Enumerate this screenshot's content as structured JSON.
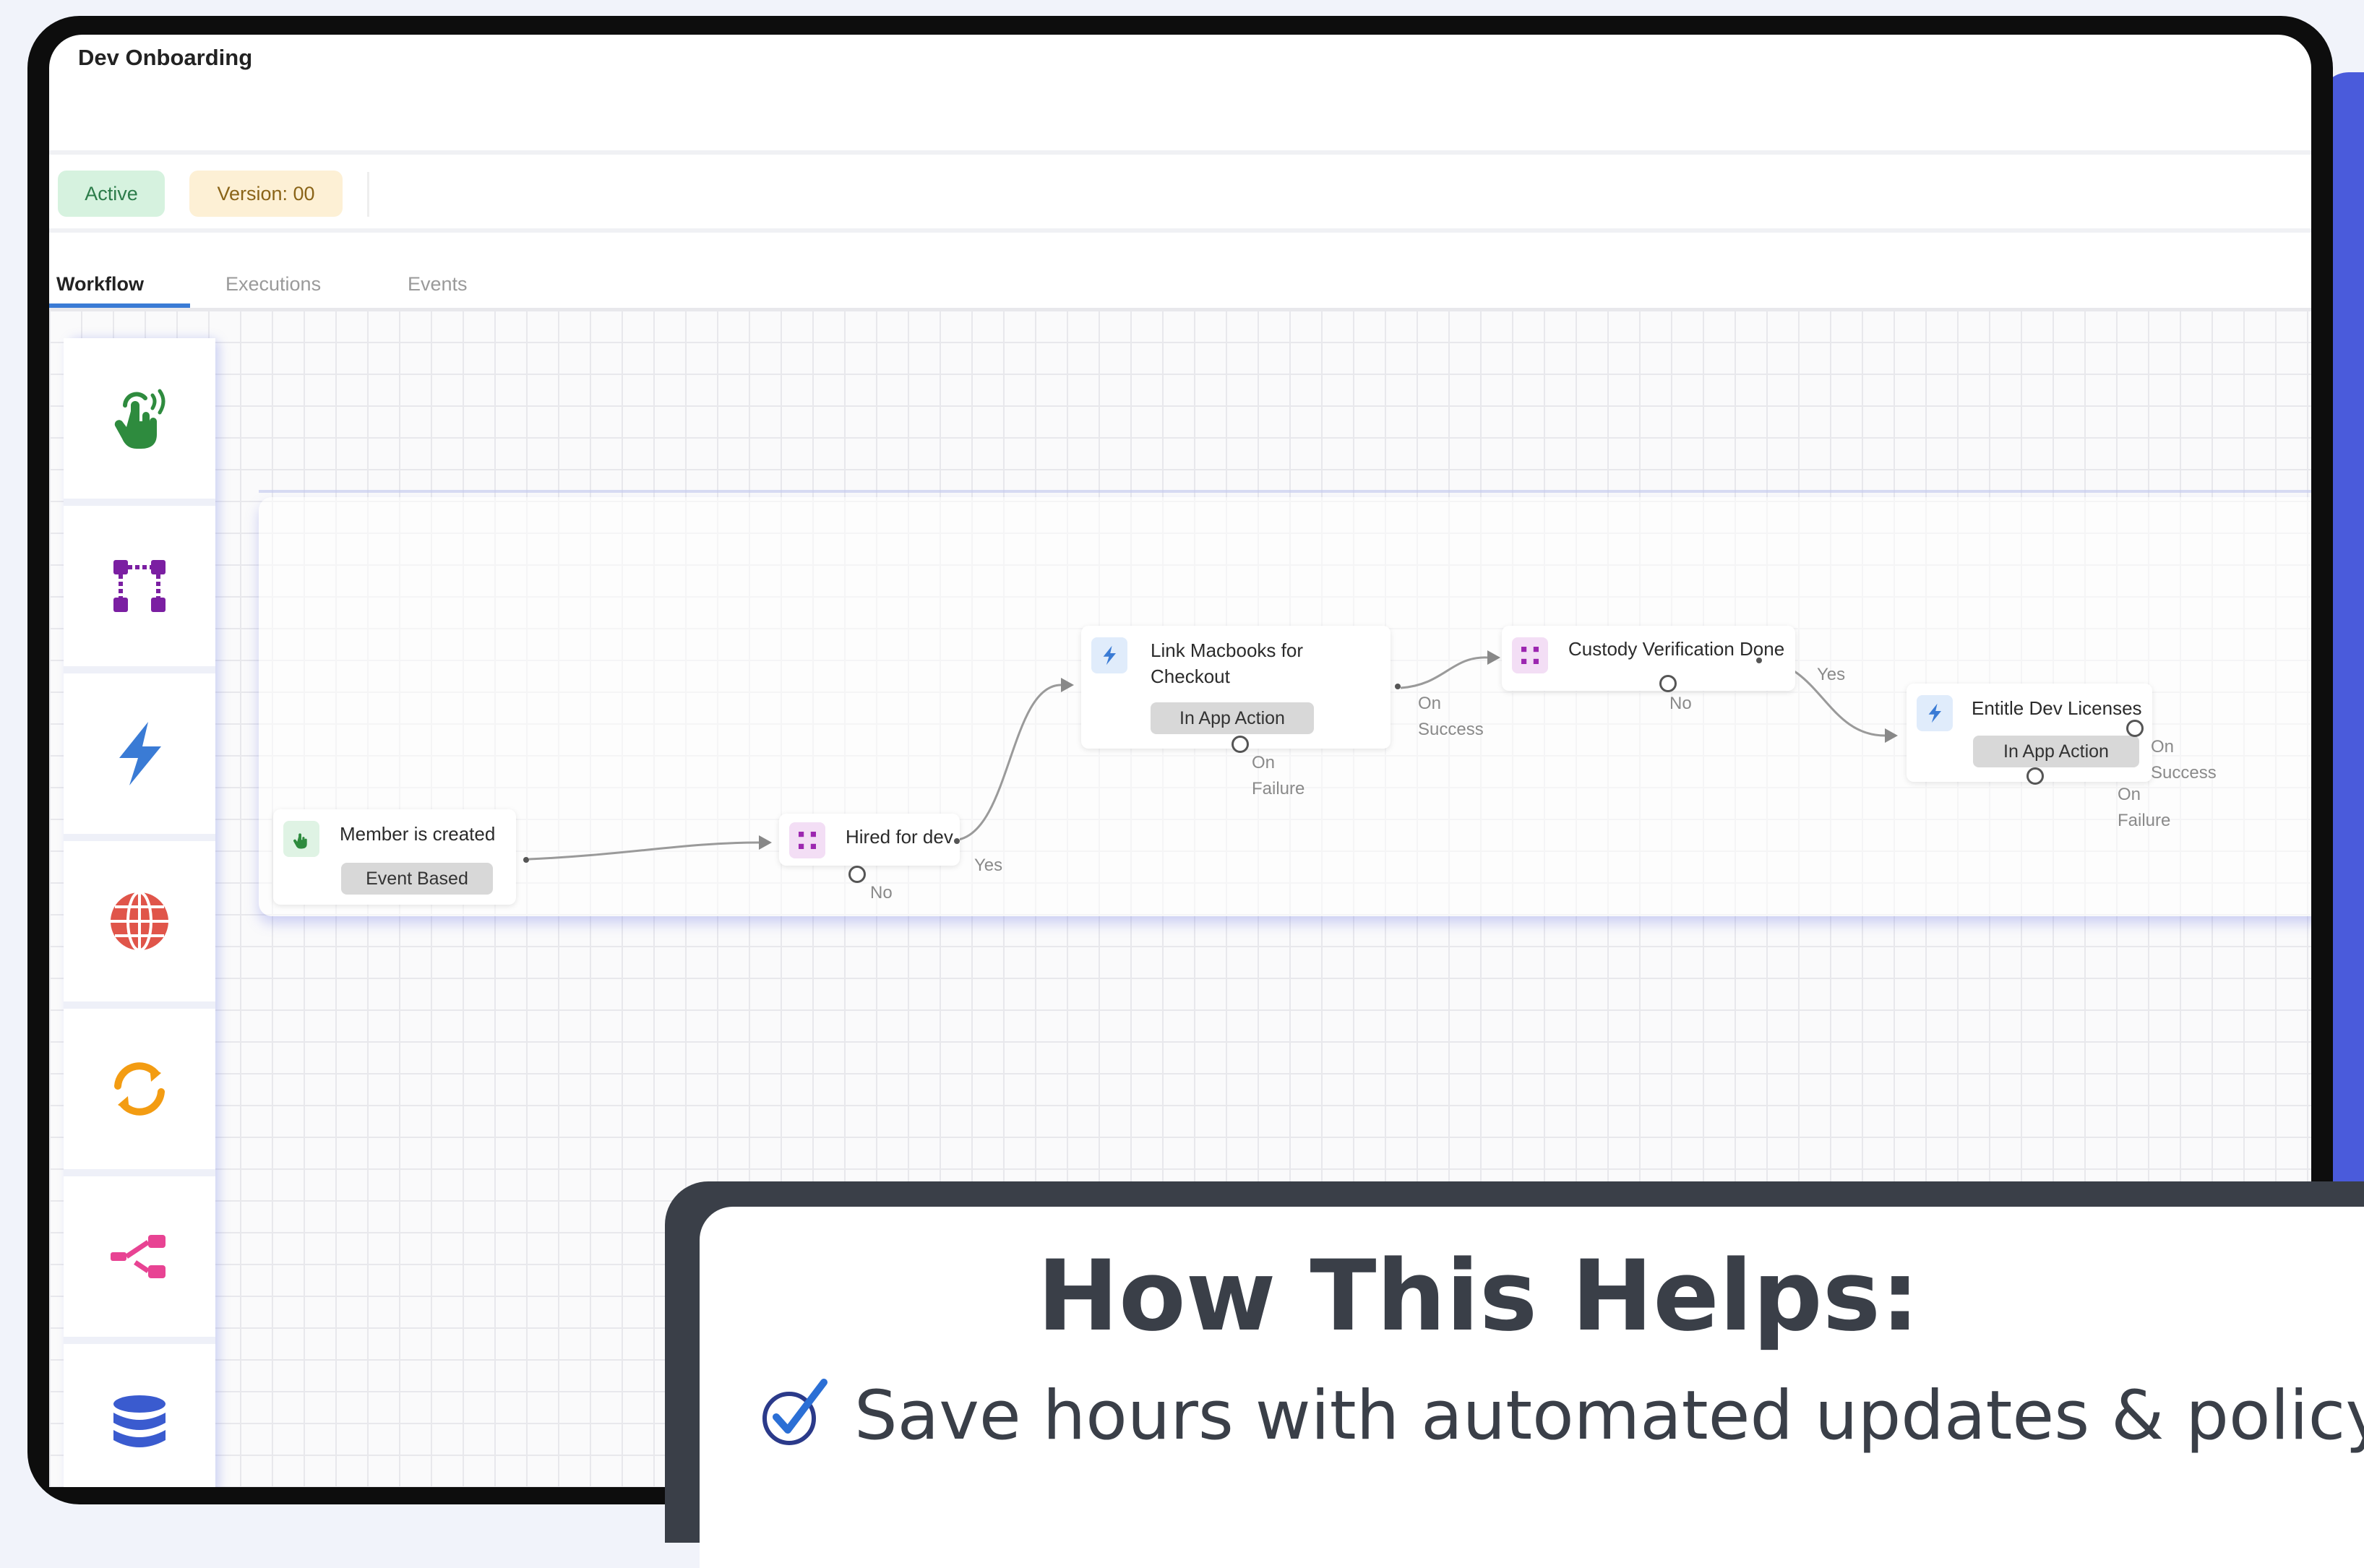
{
  "app": {
    "title": "Dev Onboarding"
  },
  "badges": {
    "status": "Active",
    "version": "Version: 00"
  },
  "tabs": [
    {
      "label": "Workflow",
      "active": true
    },
    {
      "label": "Executions",
      "active": false
    },
    {
      "label": "Events",
      "active": false
    }
  ],
  "palette": [
    {
      "icon": "hand-tap-icon",
      "color": "#2e8b3e"
    },
    {
      "icon": "branch-grid-icon",
      "color": "#7b1fa2"
    },
    {
      "icon": "lightning-icon",
      "color": "#3a7bd5"
    },
    {
      "icon": "globe-icon",
      "color": "#e0554a"
    },
    {
      "icon": "sync-icon",
      "color": "#f39c12"
    },
    {
      "icon": "route-icon",
      "color": "#e84393"
    },
    {
      "icon": "database-icon",
      "color": "#3a5bcf"
    }
  ],
  "workflow": {
    "nodes": {
      "trigger": {
        "title": "Member is created",
        "tag": "Event Based"
      },
      "condition1": {
        "title": "Hired for dev"
      },
      "action1": {
        "title_line1": "Link Macbooks for",
        "title_line2": "Checkout",
        "tag": "In App Action"
      },
      "condition2": {
        "title": "Custody Verification Done"
      },
      "action2": {
        "title": "Entitle Dev Licenses",
        "tag": "In App Action"
      }
    },
    "edge_labels": {
      "yes": "Yes",
      "no": "No",
      "on": "On",
      "success": "Success",
      "failure": "Failure"
    }
  },
  "help": {
    "title": "How This Helps:",
    "bullet": "Save hours with automated updates & policy"
  },
  "colors": {
    "accent": "#4a5bdb",
    "tab_underline": "#3a7bd5",
    "dark": "#3a3f48"
  }
}
